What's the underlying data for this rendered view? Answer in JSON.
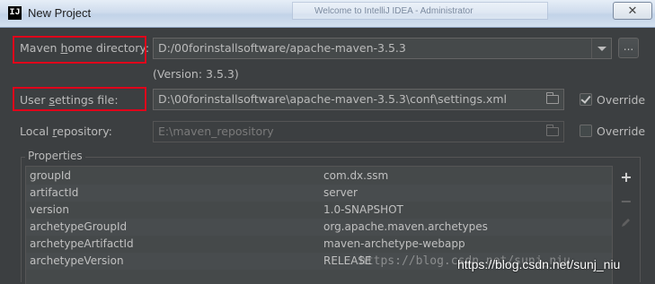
{
  "window": {
    "title": "New Project",
    "app_icon": "IJ",
    "background_tab": "Welcome to IntelliJ IDEA - Administrator",
    "close_glyph": "✕"
  },
  "maven_home": {
    "label_pre": "Maven ",
    "label_mnemonic": "h",
    "label_post": "ome directory:",
    "value": "D:/00forinstallsoftware/apache-maven-3.5.3",
    "version": "(Version: 3.5.3)",
    "browse_label": "..."
  },
  "user_settings": {
    "label_pre": "User ",
    "label_mnemonic": "s",
    "label_post": "ettings file:",
    "value": "D:\\00forinstallsoftware\\apache-maven-3.5.3\\conf\\settings.xml",
    "override_label": "Override",
    "override_checked": true
  },
  "local_repository": {
    "label_pre": "Local ",
    "label_mnemonic": "r",
    "label_post": "epository:",
    "value": "E:\\maven_repository",
    "override_label": "Override",
    "override_checked": false
  },
  "properties": {
    "title": "Properties",
    "rows": [
      {
        "key": "groupId",
        "value": "com.dx.ssm"
      },
      {
        "key": "artifactId",
        "value": "server"
      },
      {
        "key": "version",
        "value": "1.0-SNAPSHOT"
      },
      {
        "key": "archetypeGroupId",
        "value": "org.apache.maven.archetypes"
      },
      {
        "key": "archetypeArtifactId",
        "value": "maven-archetype-webapp"
      },
      {
        "key": "archetypeVersion",
        "value": "RELEASE"
      }
    ],
    "add_glyph": "+",
    "remove_glyph": "−"
  },
  "watermark": {
    "text": "https://blog.csdn.net/sunj_niu",
    "overlay": "https://blog.csdn.net/sunj_niu"
  },
  "colors": {
    "highlight_box": "#e0001a",
    "dialog_bg": "#3c3f41"
  }
}
